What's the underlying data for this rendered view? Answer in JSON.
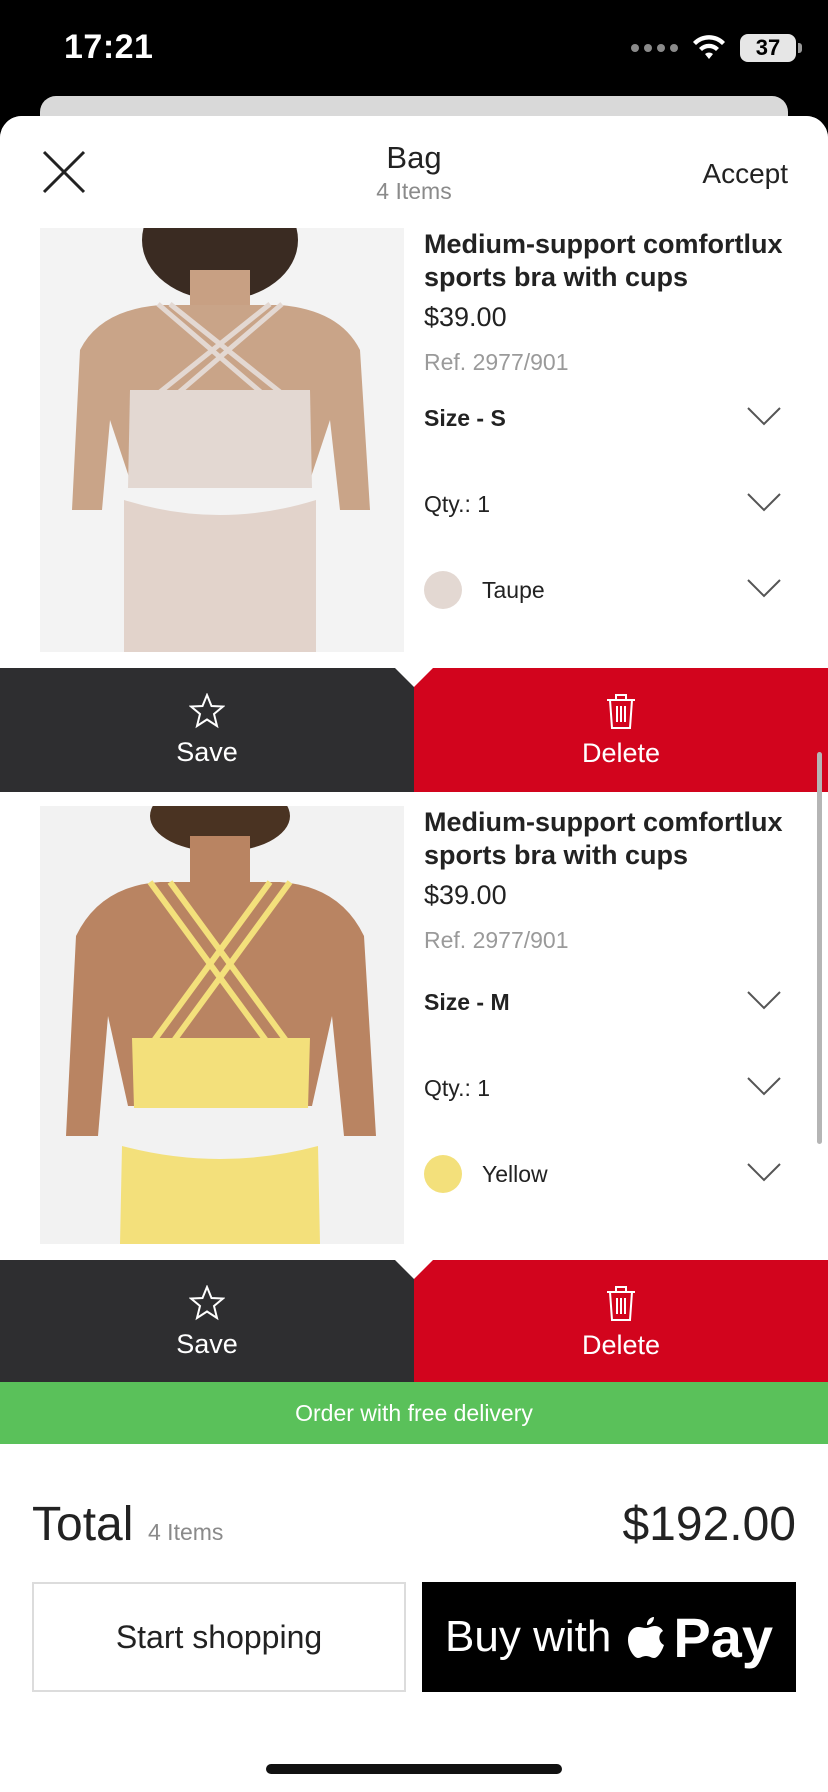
{
  "status_bar": {
    "time": "17:21",
    "battery": "37"
  },
  "header": {
    "title": "Bag",
    "subtitle": "4 Items",
    "accept_label": "Accept",
    "close_icon": "close-icon"
  },
  "items": [
    {
      "name": "Medium-support comfortlux sports bra with cups",
      "price": "$39.00",
      "ref": "Ref. 2977/901",
      "size": "Size - S",
      "qty": "Qty.: 1",
      "color_name": "Taupe",
      "color_hex": "#e3d8d2",
      "save_label": "Save",
      "delete_label": "Delete"
    },
    {
      "name": "Medium-support comfortlux sports bra with cups",
      "price": "$39.00",
      "ref": "Ref. 2977/901",
      "size": "Size - M",
      "qty": "Qty.: 1",
      "color_name": "Yellow",
      "color_hex": "#f3e07b",
      "save_label": "Save",
      "delete_label": "Delete"
    }
  ],
  "promo": {
    "text": "Order with free delivery",
    "color": "#5ac15a"
  },
  "summary": {
    "total_label": "Total",
    "item_count": "4 Items",
    "total_amount": "$192.00"
  },
  "buttons": {
    "start_shopping": "Start shopping",
    "buy_with": "Buy with",
    "pay": "Pay"
  },
  "colors": {
    "delete_red": "#d2041d",
    "save_dark": "#2e2e30"
  }
}
